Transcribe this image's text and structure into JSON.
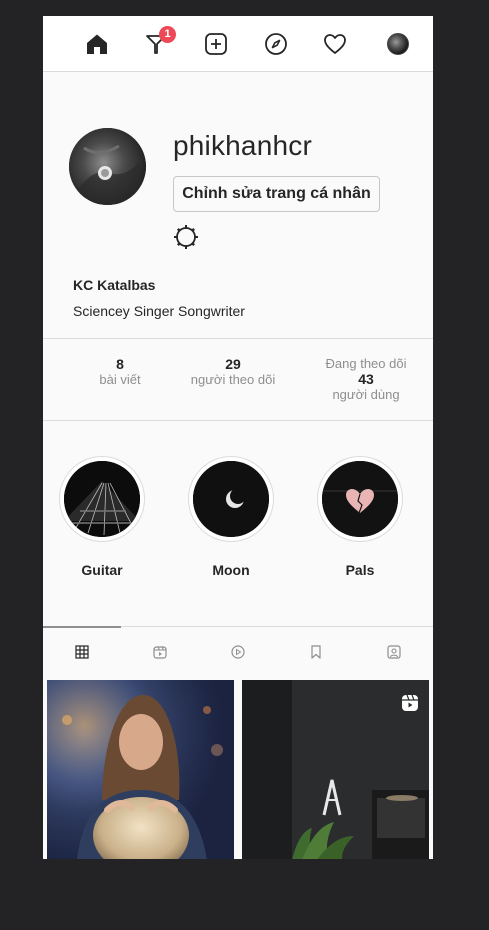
{
  "nav": {
    "items": [
      {
        "name": "home",
        "icon": "home-icon"
      },
      {
        "name": "direct",
        "icon": "direct-message-icon"
      },
      {
        "name": "new-post",
        "icon": "add-post-icon"
      },
      {
        "name": "explore",
        "icon": "compass-icon"
      },
      {
        "name": "activity",
        "icon": "heart-icon"
      },
      {
        "name": "profile",
        "icon": "avatar"
      }
    ],
    "direct_badge": "1"
  },
  "profile": {
    "username": "phikhanhcr",
    "edit_button": "Chỉnh sửa trang cá nhân",
    "full_name": "KC Katalbas",
    "bio": "Sciencey Singer Songwriter"
  },
  "stats": {
    "posts": {
      "value": "8",
      "label": "bài viết"
    },
    "followers": {
      "value": "29",
      "label": "người theo dõi"
    },
    "following": {
      "prefix": "Đang theo dõi",
      "value": "43",
      "label": "người dùng"
    }
  },
  "highlights": [
    {
      "label": "Guitar"
    },
    {
      "label": "Moon"
    },
    {
      "label": "Pals"
    }
  ],
  "tabs": [
    {
      "name": "posts",
      "icon": "grid-icon",
      "active": true
    },
    {
      "name": "igtv",
      "icon": "igtv-icon"
    },
    {
      "name": "reels",
      "icon": "play-circle-icon"
    },
    {
      "name": "saved",
      "icon": "bookmark-icon"
    },
    {
      "name": "tagged",
      "icon": "tagged-user-icon"
    }
  ],
  "colors": {
    "background": "#232325",
    "surface": "#fafafa",
    "border": "#dbdbdb",
    "text": "#262626",
    "muted": "#8e8e8e",
    "badge": "#ed4956"
  }
}
